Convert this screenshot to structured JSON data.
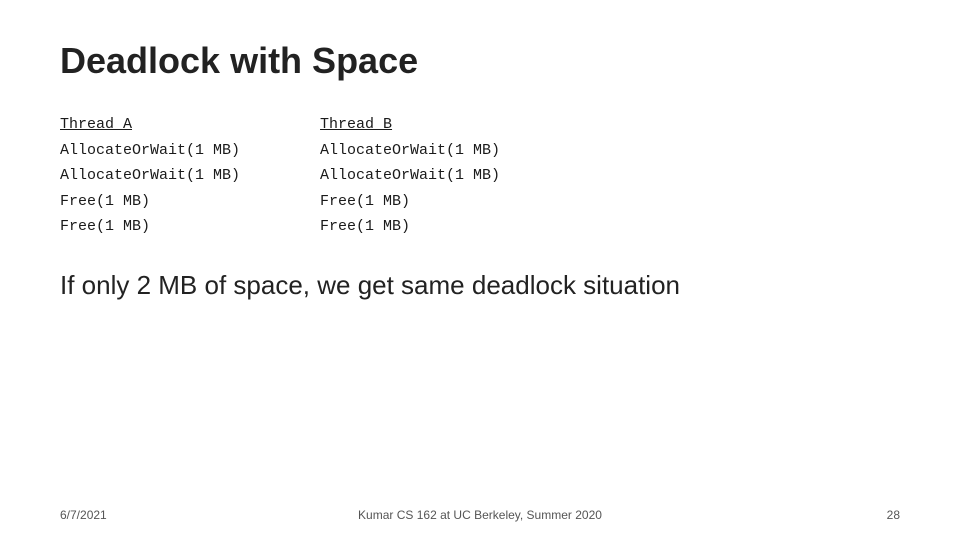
{
  "slide": {
    "title": "Deadlock with Space",
    "thread_a": {
      "label": "Thread A",
      "lines": [
        "AllocateOrWait(1 MB)",
        "AllocateOrWait(1 MB)",
        "Free(1 MB)",
        "Free(1 MB)"
      ]
    },
    "thread_b": {
      "label": "Thread B",
      "lines": [
        "AllocateOrWait(1 MB)",
        "AllocateOrWait(1 MB)",
        "Free(1 MB)",
        "Free(1 MB)"
      ]
    },
    "description": "If only 2 MB of space, we get same deadlock situation",
    "footer": {
      "date": "6/7/2021",
      "center": "Kumar CS 162 at UC Berkeley, Summer 2020",
      "page": "28"
    }
  }
}
